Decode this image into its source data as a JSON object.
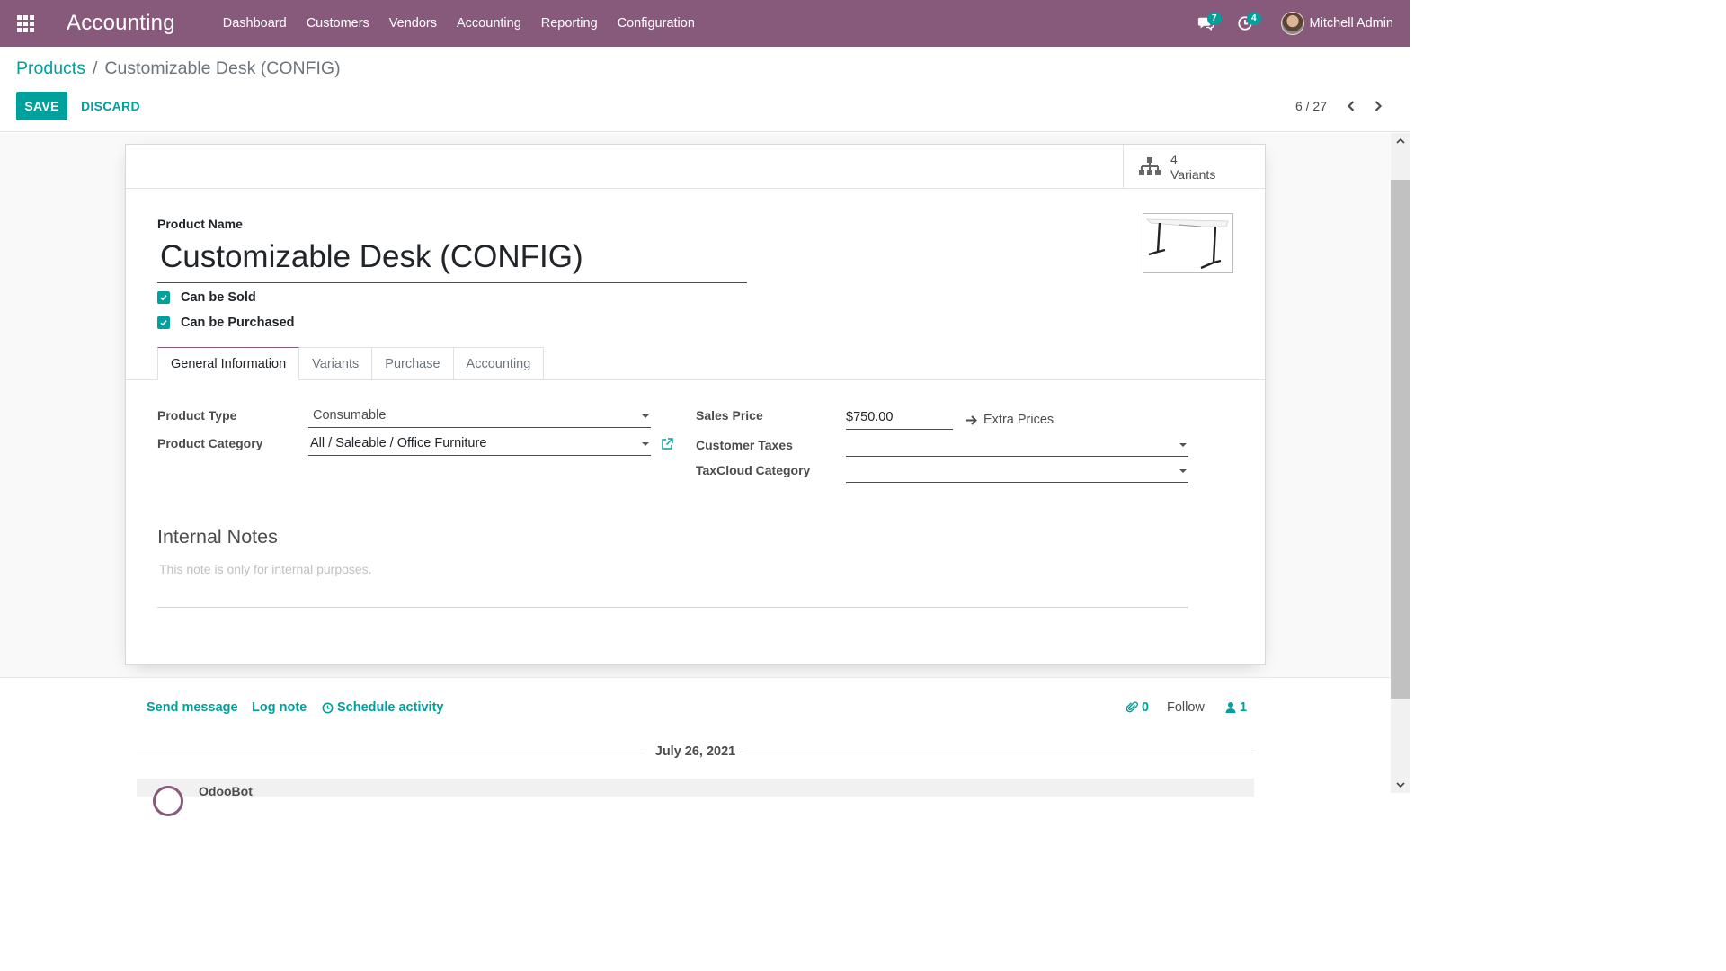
{
  "navbar": {
    "brand": "Accounting",
    "menu": [
      "Dashboard",
      "Customers",
      "Vendors",
      "Accounting",
      "Reporting",
      "Configuration"
    ],
    "messages_count": "7",
    "activities_count": "4",
    "user_name": "Mitchell Admin",
    "bg_color": "#875a7b"
  },
  "control": {
    "breadcrumb_parent": "Products",
    "breadcrumb_separator": "/",
    "breadcrumb_current": "Customizable Desk (CONFIG)",
    "save_label": "SAVE",
    "discard_label": "DISCARD",
    "pager": "6 / 27"
  },
  "sheet": {
    "variants_count": "4",
    "variants_label": "Variants",
    "product_name_label": "Product Name",
    "product_name": "Customizable Desk (CONFIG)",
    "can_be_sold_label": "Can be Sold",
    "can_be_sold": true,
    "can_be_purchased_label": "Can be Purchased",
    "can_be_purchased": true,
    "tabs": [
      "General Information",
      "Variants",
      "Purchase",
      "Accounting"
    ],
    "active_tab": "General Information",
    "product_type_label": "Product Type",
    "product_type": "Consumable",
    "product_category_label": "Product Category",
    "product_category": "All / Saleable / Office Furniture",
    "sales_price_label": "Sales Price",
    "sales_price": "$750.00",
    "extra_prices_label": "Extra Prices",
    "customer_taxes_label": "Customer Taxes",
    "customer_taxes": "",
    "taxcloud_label": "TaxCloud Category",
    "taxcloud": "",
    "internal_notes_title": "Internal Notes",
    "internal_notes_placeholder": "This note is only for internal purposes."
  },
  "chatter": {
    "send_message": "Send message",
    "log_note": "Log note",
    "schedule_activity": "Schedule activity",
    "attachments_count": "0",
    "follow_label": "Follow",
    "followers_count": "1",
    "date": "July 26, 2021",
    "author": "OdooBot"
  },
  "colors": {
    "primary": "#00a09d",
    "brand": "#875a7b"
  }
}
